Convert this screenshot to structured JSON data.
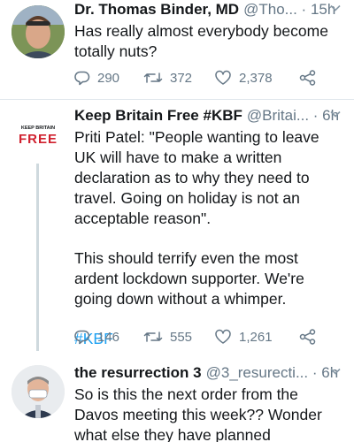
{
  "tweets": [
    {
      "name": "Dr. Thomas Binder, MD",
      "handle": "@Tho...",
      "sep": " · ",
      "time": "15h",
      "text": "Has really almost everybody become totally nuts?",
      "replies": "290",
      "retweets": "372",
      "likes": "2,378"
    },
    {
      "name": "Keep Britain Free #KBF",
      "handle": "@Britai...",
      "sep": " · ",
      "time": "6h",
      "avatar_top": "KEEP BRITAIN",
      "avatar_bottom": "FREE",
      "text1": "Priti Patel: \"People wanting to leave UK will have to make a written declaration as to why they need to travel. Going on holiday is not an acceptable reason\".",
      "text2": "This should terrify even the most ardent lockdown supporter. We're going down without a whimper.",
      "hashtag": "#KBF",
      "replies": "146",
      "retweets": "555",
      "likes": "1,261"
    },
    {
      "name": "the resurrection 3",
      "handle": "@3_resurecti...",
      "sep": " · ",
      "time": "6h",
      "text": "So is this the next order from the Davos meeting this week?? Wonder what else they have planned"
    }
  ],
  "colors": {
    "accent": "#1da1f2",
    "secondary_text": "#657786",
    "kbf_red": "#d0202e",
    "divider": "#e1e8ed"
  },
  "icons": [
    "reply-icon",
    "retweet-icon",
    "like-icon",
    "share-icon",
    "chevron-down-icon"
  ]
}
